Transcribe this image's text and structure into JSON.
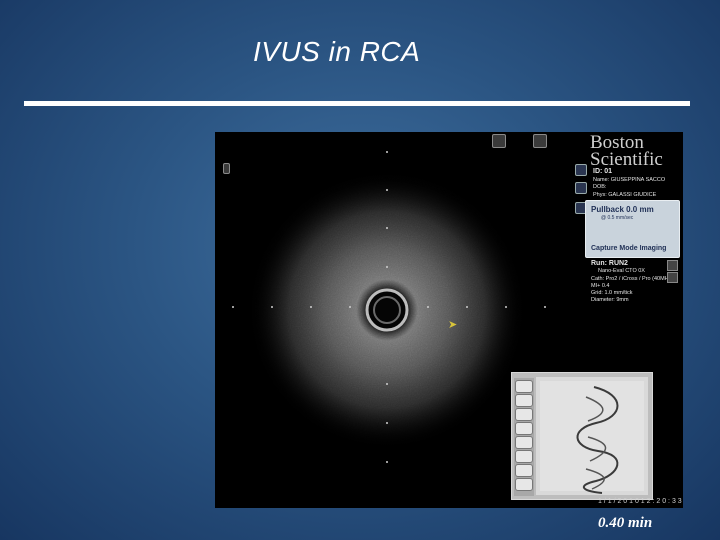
{
  "slide": {
    "title": "IVUS in RCA",
    "time_label": "0.40 min",
    "background_color": "#2b5583",
    "title_color": "#ffffff"
  },
  "viewer": {
    "brand_line1": "Boston",
    "brand_line2": "Scientific",
    "id": "ID: 01",
    "name": "Name: GIUSEPPINA SACCO",
    "dob": "DOB:",
    "phys": "Phys: GALASSI GIUDICE",
    "pullback_title": "Pullback 0.0 mm",
    "pullback_sub": "@ 0.5 mm/sec",
    "capture_mode": "Capture Mode Imaging",
    "run": "Run: RUN2",
    "run_sub": "Nano-Eval CTO 0X",
    "cath": "Cath:  Pro2 / iCross / Pro (40MHz)",
    "mi": "MI+  0.4",
    "grid": "Grid:   1.0 mm/tick",
    "diameter": "Diameter:  9mm",
    "date_stamp": "1 / 1 / 2 0 1 0   1 2 : 2 0 : 3 3"
  },
  "icons": {
    "toolbar": [
      "monitor-icon",
      "plus-icon",
      "grid-icon"
    ],
    "side": [
      "settings-icon",
      "image-icon",
      "save-icon"
    ],
    "cursor": "arrow-cursor-icon"
  }
}
